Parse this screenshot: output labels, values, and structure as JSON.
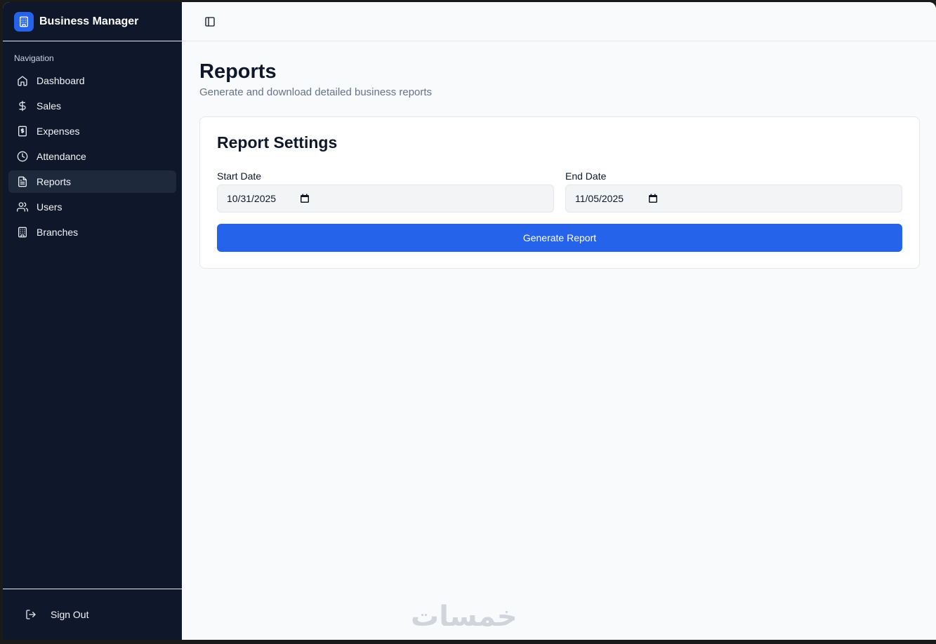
{
  "app": {
    "title": "Business Manager"
  },
  "sidebar": {
    "section_label": "Navigation",
    "items": [
      {
        "label": "Dashboard",
        "icon": "home-icon"
      },
      {
        "label": "Sales",
        "icon": "dollar-icon"
      },
      {
        "label": "Expenses",
        "icon": "receipt-icon"
      },
      {
        "label": "Attendance",
        "icon": "clock-icon"
      },
      {
        "label": "Reports",
        "icon": "file-text-icon",
        "active": true
      },
      {
        "label": "Users",
        "icon": "users-icon"
      },
      {
        "label": "Branches",
        "icon": "building-icon"
      }
    ],
    "sign_out_label": "Sign Out"
  },
  "page": {
    "title": "Reports",
    "subtitle": "Generate and download detailed business reports"
  },
  "report_settings": {
    "title": "Report Settings",
    "start_date_label": "Start Date",
    "start_date_value": "10/31/2025",
    "end_date_label": "End Date",
    "end_date_value": "11/05/2025",
    "generate_label": "Generate Report"
  },
  "watermark": {
    "text": "خمسات"
  },
  "colors": {
    "sidebar_bg": "#0f172a",
    "accent": "#2563eb",
    "active_item_bg": "#1e293b",
    "page_bg": "#f9fafb"
  }
}
